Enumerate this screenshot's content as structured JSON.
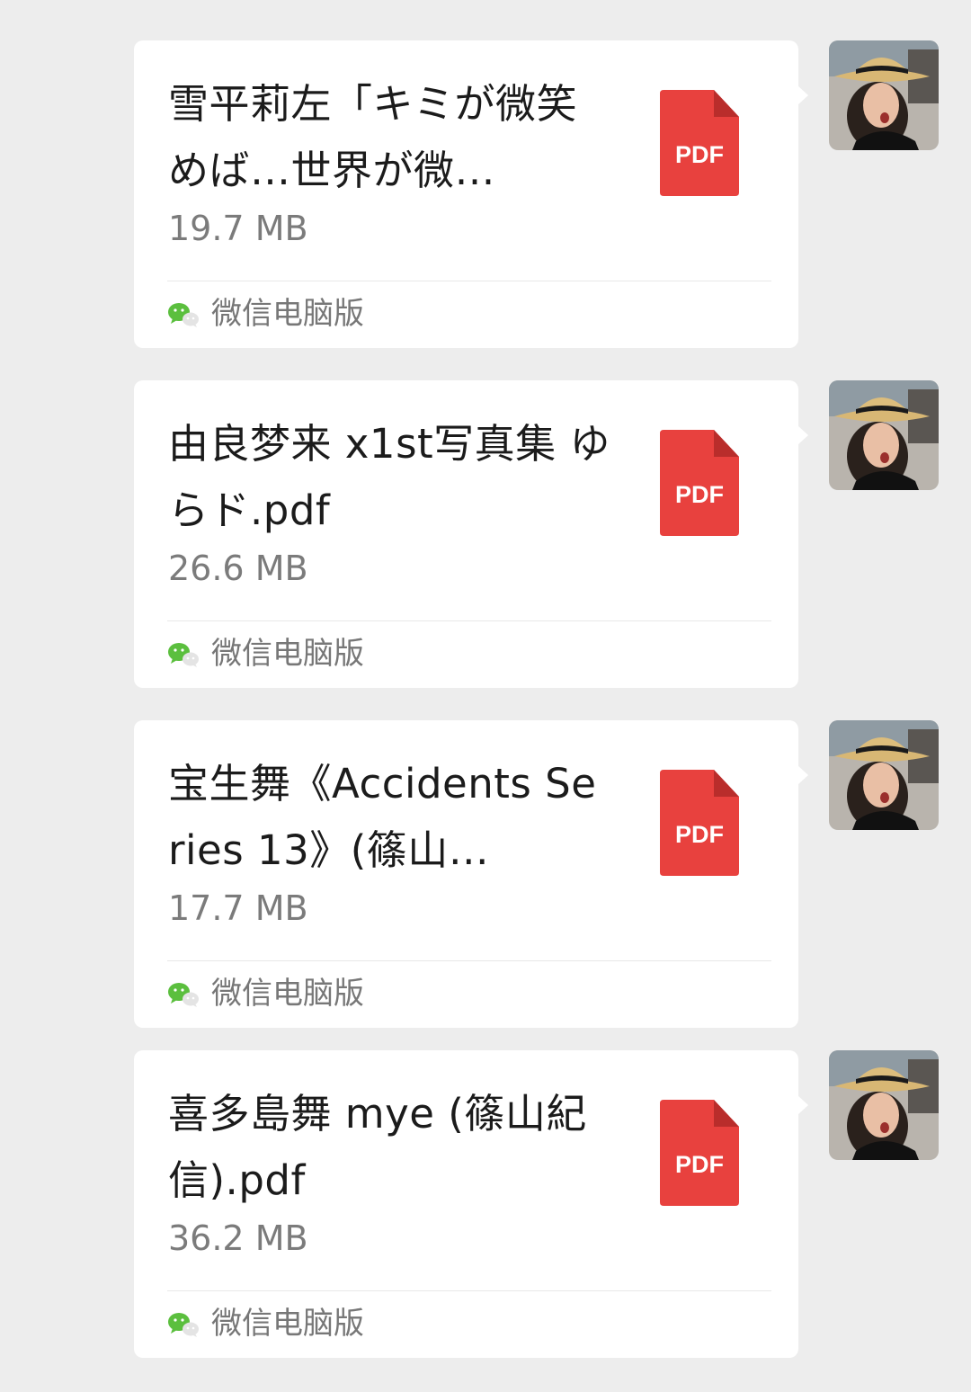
{
  "messages": [
    {
      "file_name": "雪平莉左「キミが微笑めば…世界が微…",
      "file_size": "19.7 MB",
      "file_type": "PDF",
      "source": "微信电脑版"
    },
    {
      "file_name": "由良梦来 x1st写真集 ゆらド.pdf",
      "file_size": "26.6 MB",
      "file_type": "PDF",
      "source": "微信电脑版"
    },
    {
      "file_name": "宝生舞《Accidents Series 13》(篠山…",
      "file_size": "17.7 MB",
      "file_type": "PDF",
      "source": "微信电脑版"
    },
    {
      "file_name": "喜多島舞 mye (篠山紀信).pdf",
      "file_size": "36.2 MB",
      "file_type": "PDF",
      "source": "微信电脑版"
    }
  ],
  "icons": {
    "file": "pdf-file-icon",
    "source": "wechat-icon",
    "avatar": "user-avatar"
  },
  "colors": {
    "background": "#ededed",
    "bubble": "#ffffff",
    "pdf_red": "#e8413e",
    "wechat_green": "#5bbf3e"
  }
}
